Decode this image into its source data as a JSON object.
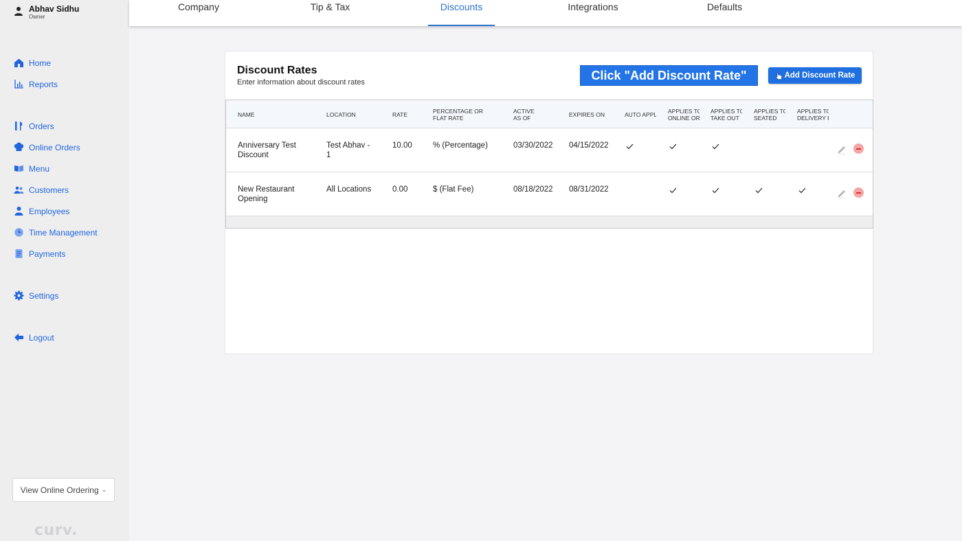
{
  "user": {
    "name": "Abhav Sidhu",
    "role": "Owner"
  },
  "nav": {
    "home": "Home",
    "reports": "Reports",
    "orders": "Orders",
    "online_orders": "Online Orders",
    "menu": "Menu",
    "customers": "Customers",
    "employees": "Employees",
    "time_management": "Time Management",
    "payments": "Payments",
    "settings": "Settings",
    "logout": "Logout"
  },
  "view_online_ordering": "View Online Ordering",
  "logo_text": "curv.",
  "tabs": [
    "Company",
    "Tip & Tax",
    "Discounts",
    "Integrations",
    "Defaults"
  ],
  "active_tab": "Discounts",
  "card": {
    "title": "Discount Rates",
    "subtitle": "Enter information about discount rates",
    "callout": "Click \"Add Discount Rate\"",
    "add_button": "Add Discount Rate"
  },
  "table": {
    "headers": [
      "NAME",
      "LOCATION",
      "RATE",
      "PERCENTAGE OR\nFLAT RATE",
      "ACTIVE\nAS OF",
      "EXPIRES ON",
      "AUTO APPLY",
      "APPLIES TO\nONLINE ORDERS",
      "APPLIES TO\nTAKE OUT",
      "APPLIES TO\nSEATED",
      "APPLIES TO\nDELIVERY F"
    ],
    "rows": [
      {
        "name": "Anniversary Test\nDiscount",
        "location": "Test Abhav -\n1",
        "rate": "10.00",
        "type": "% (Percentage)",
        "active": "03/30/2022",
        "expires": "04/15/2022",
        "auto_apply": true,
        "online": true,
        "take_out": true,
        "seated": false,
        "delivery": false
      },
      {
        "name": "New Restaurant\nOpening",
        "location": "All Locations",
        "rate": "0.00",
        "type": "$ (Flat Fee)",
        "active": "08/18/2022",
        "expires": "08/31/2022",
        "auto_apply": false,
        "online": true,
        "take_out": true,
        "seated": true,
        "delivery": true
      }
    ]
  },
  "colors": {
    "accent": "#2266dd",
    "primary_button": "#1f6fe0",
    "callout": "#2374e6"
  }
}
